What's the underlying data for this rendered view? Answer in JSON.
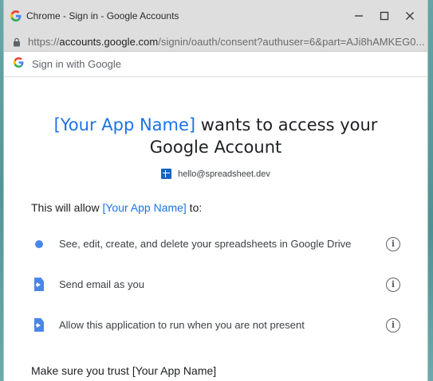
{
  "window": {
    "title": "Chrome - Sign in - Google Accounts",
    "url_scheme": "https://",
    "url_host": "accounts.google.com",
    "url_path": "/signin/oauth/consent?authuser=6&part=AJi8hAMKEG0..."
  },
  "header": {
    "label": "Sign in with Google"
  },
  "main": {
    "app_name": "[Your App Name]",
    "headline_rest": " wants to access your Google Account",
    "account_email": "hello@spreadsheet.dev",
    "allow_prefix": "This will allow ",
    "allow_suffix": " to:",
    "scopes": [
      {
        "icon": "circle-icon",
        "label": "See, edit, create, and delete your spreadsheets in Google Drive"
      },
      {
        "icon": "apps-script-icon",
        "label": "Send email as you"
      },
      {
        "icon": "apps-script-icon",
        "label": "Allow this application to run when you are not present"
      }
    ],
    "trust_text": "Make sure you trust [Your App Name]"
  },
  "colors": {
    "accent": "#1a73e8",
    "scope_icon": "#4a86e8",
    "titlebar": "#dedede"
  }
}
